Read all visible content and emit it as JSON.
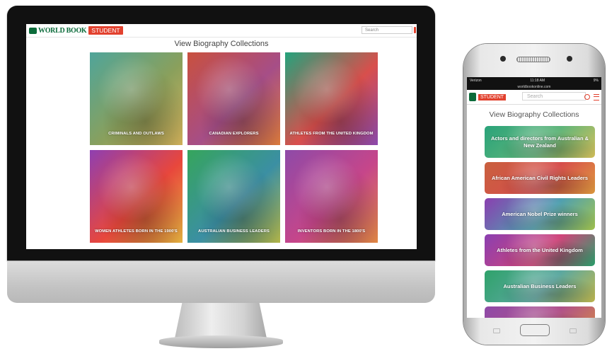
{
  "desktop": {
    "logo_text": "WORLD BOOK",
    "logo_badge": "STUDENT",
    "search_placeholder": "Search",
    "title": "View Biography Collections",
    "tiles": [
      {
        "label": "CRIMINALS AND OUTLAWS",
        "colors": [
          "#4fa59a",
          "#8aa05c",
          "#d3b25b"
        ]
      },
      {
        "label": "CANADIAN EXPLORERS",
        "colors": [
          "#c9503e",
          "#a64e87",
          "#e07d3c"
        ]
      },
      {
        "label": "ATHLETES FROM THE UNITED KINGDOM",
        "colors": [
          "#24a37c",
          "#d84f4c",
          "#8f4bb1"
        ]
      },
      {
        "label": "WOMEN ATHLETES BORN IN THE 1900'S",
        "colors": [
          "#8f3fb1",
          "#e8473c",
          "#e8b540"
        ]
      },
      {
        "label": "AUSTRALIAN BUSINESS LEADERS",
        "colors": [
          "#36a55c",
          "#3b8fa3",
          "#b6b94a"
        ]
      },
      {
        "label": "INVENTORS BORN IN THE 1800'S",
        "colors": [
          "#8e4aa8",
          "#c6468a",
          "#e58a45"
        ]
      }
    ]
  },
  "phone": {
    "status_carrier": "Verizon",
    "status_time": "11:18 AM",
    "status_battery": "9%",
    "url": "worldbookonline.com",
    "badge": "STUDENT",
    "search_placeholder": "Search",
    "title": "View Biography Collections",
    "cards": [
      {
        "label": "Actors and directors from Australian & New Zealand",
        "colors": [
          "#2aa37a",
          "#5fb57a",
          "#d6c15a"
        ]
      },
      {
        "label": "African American Civil Rights Leaders",
        "colors": [
          "#c9603e",
          "#d64e4c",
          "#e09a3e"
        ]
      },
      {
        "label": "American Nobel Prize winners",
        "colors": [
          "#8a3fb0",
          "#4f9fb0",
          "#a4c64e"
        ]
      },
      {
        "label": "Athletes from the United Kingdom",
        "colors": [
          "#8a3fb1",
          "#d0447a",
          "#2aa36d"
        ]
      },
      {
        "label": "Australian Business Leaders",
        "colors": [
          "#2fa26a",
          "#5ba8a0",
          "#c0b84e"
        ]
      },
      {
        "label": "",
        "colors": [
          "#8e4aa8",
          "#b0508a",
          "#d58a45"
        ]
      }
    ]
  }
}
